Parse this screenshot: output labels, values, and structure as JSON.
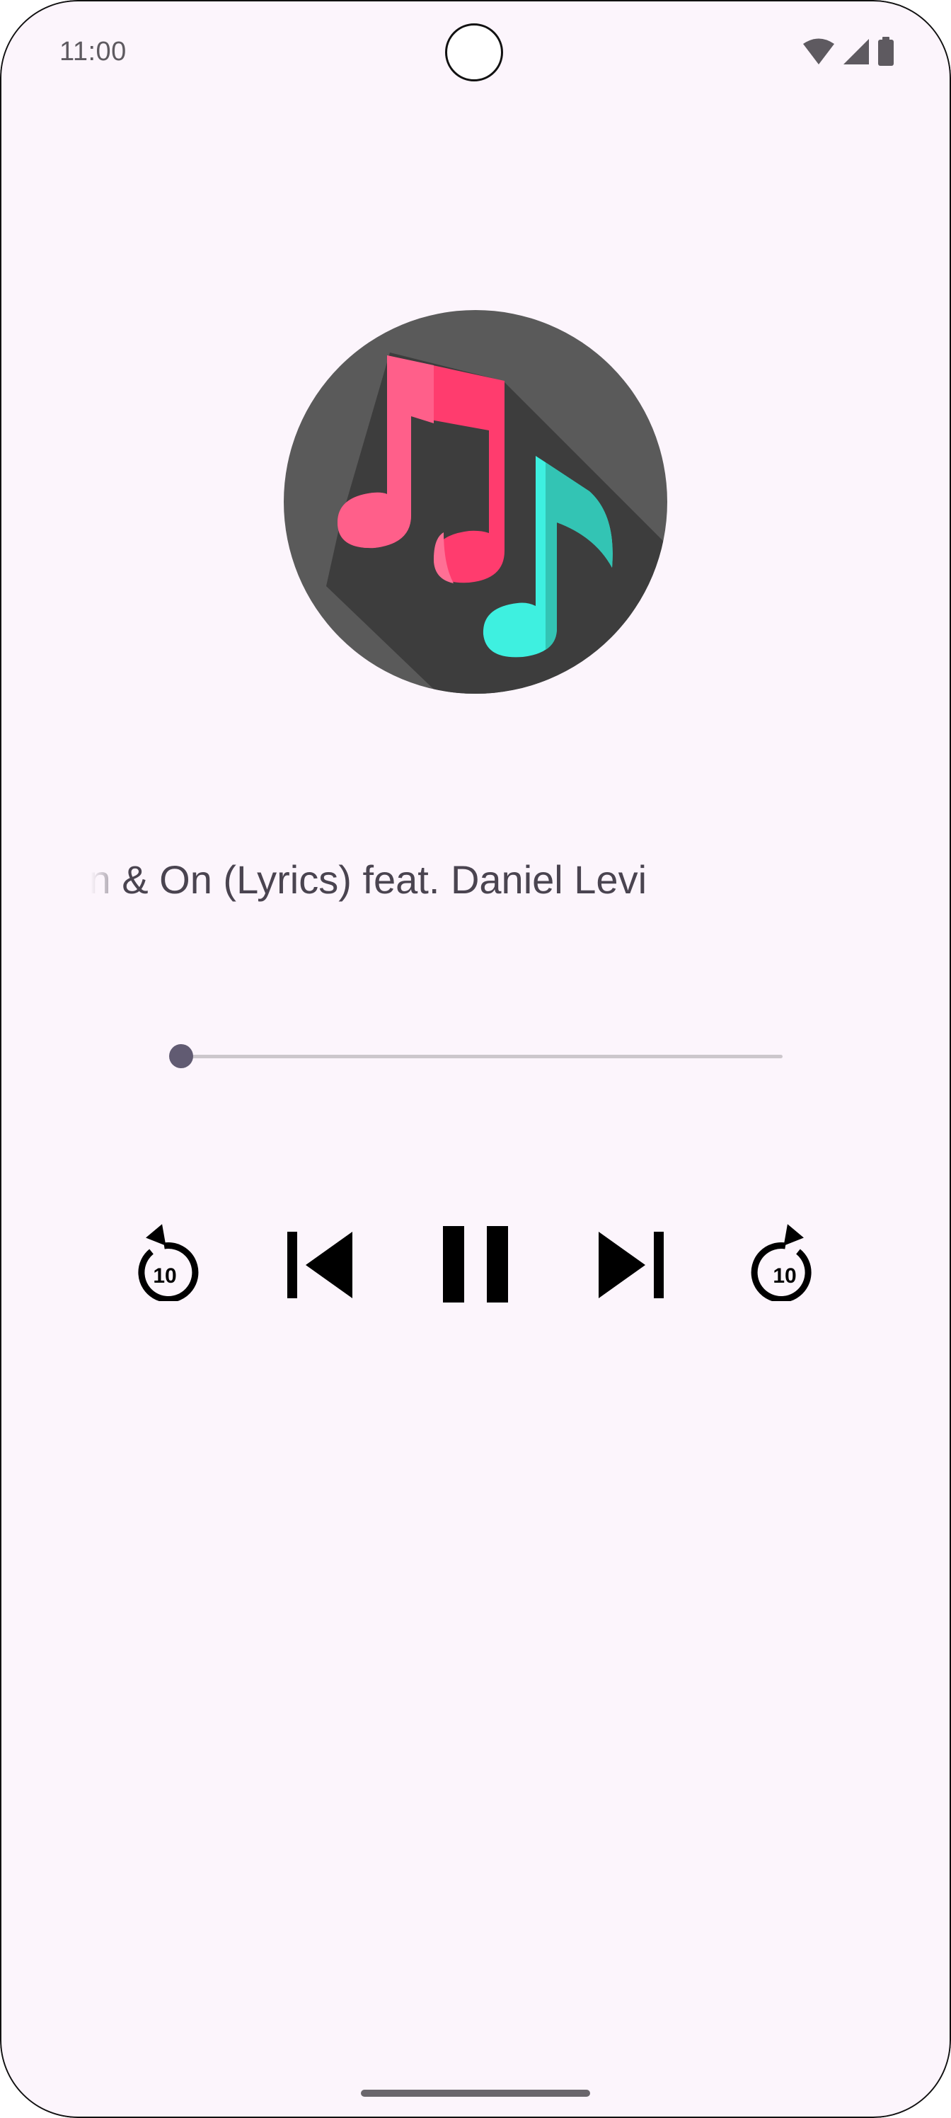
{
  "status_bar": {
    "time": "11:00"
  },
  "player": {
    "title": "On & On (Lyrics) feat. Daniel Levi",
    "progress": 0.0,
    "controls": {
      "replay_10_label": "10",
      "forward_10_label": "10"
    }
  },
  "colors": {
    "background": "#fcf5fc",
    "accent": "#615b72",
    "track_inactive": "#ccc7cc",
    "note_pink": "#ff3c6e",
    "note_teal": "#3ee8d8",
    "disc": "#5a5a5a"
  },
  "icons": {
    "status": [
      "wifi-icon",
      "signal-icon",
      "battery-icon"
    ],
    "controls": [
      "replay-10-icon",
      "skip-previous-icon",
      "pause-icon",
      "skip-next-icon",
      "forward-10-icon"
    ]
  }
}
